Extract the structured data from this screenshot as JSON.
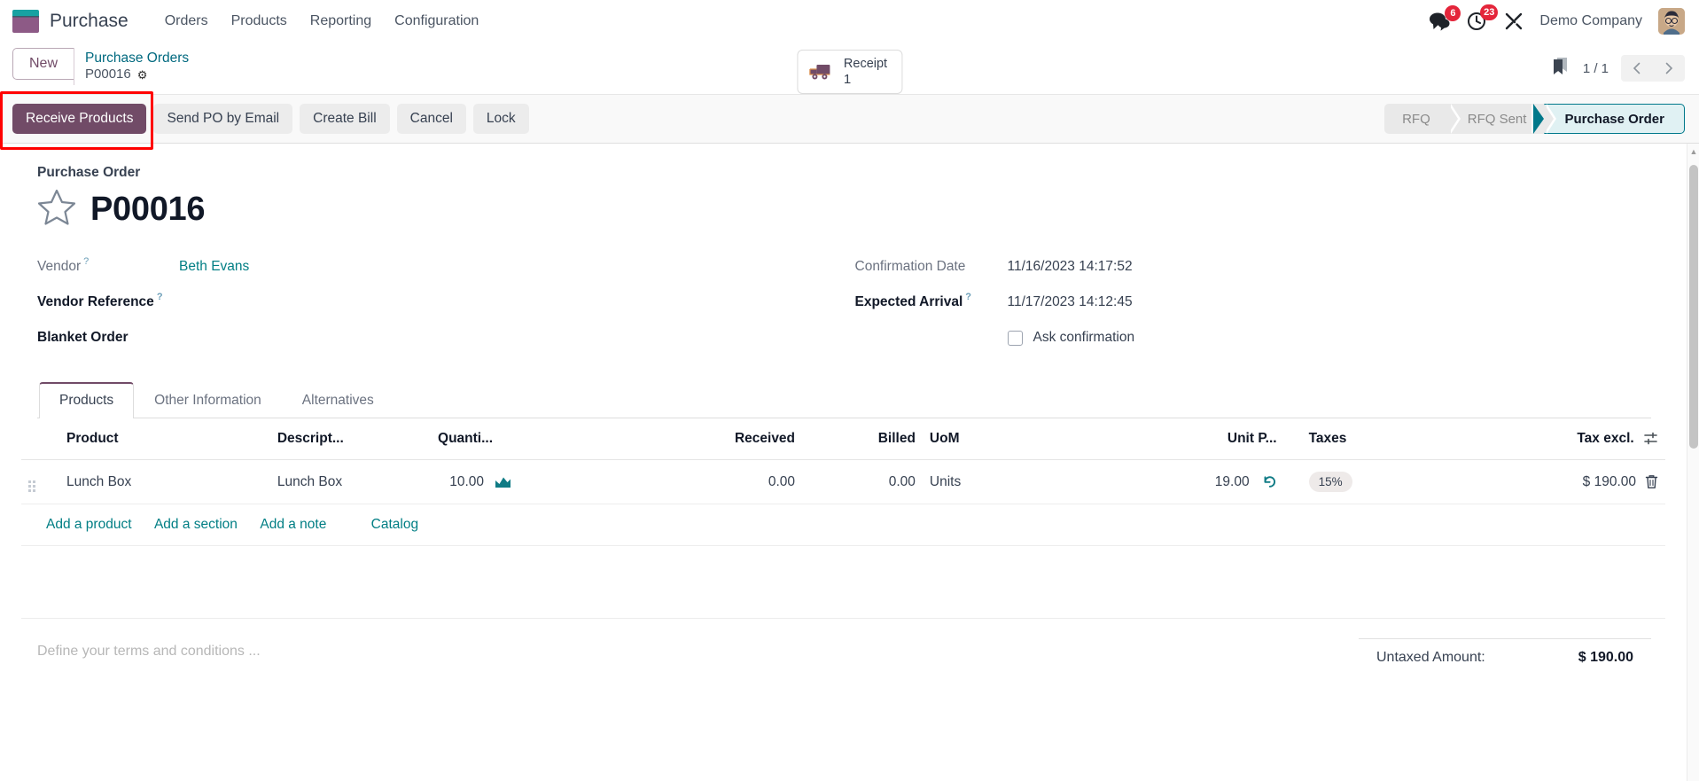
{
  "navbar": {
    "brand": "Purchase",
    "menu": [
      {
        "label": "Orders"
      },
      {
        "label": "Products"
      },
      {
        "label": "Reporting"
      },
      {
        "label": "Configuration"
      }
    ],
    "messages_count": "6",
    "activities_count": "23",
    "company": "Demo Company"
  },
  "control_panel": {
    "new_label": "New",
    "breadcrumb_parent": "Purchase Orders",
    "breadcrumb_current": "P00016",
    "smart_button": {
      "label": "Receipt",
      "value": "1"
    },
    "pager": "1 / 1"
  },
  "action_bar": {
    "buttons": [
      {
        "label": "Receive Products",
        "style": "primary",
        "highlighted": true
      },
      {
        "label": "Send PO by Email",
        "style": "secondary"
      },
      {
        "label": "Create Bill",
        "style": "secondary"
      },
      {
        "label": "Cancel",
        "style": "secondary"
      },
      {
        "label": "Lock",
        "style": "secondary"
      }
    ],
    "statusbar": [
      {
        "label": "RFQ",
        "active": false
      },
      {
        "label": "RFQ Sent",
        "active": false
      },
      {
        "label": "Purchase Order",
        "active": true
      }
    ]
  },
  "form": {
    "subtitle": "Purchase Order",
    "title": "P00016",
    "left_fields": [
      {
        "label": "Vendor",
        "help": "?",
        "value": "Beth Evans",
        "filled": true,
        "link": true
      },
      {
        "label": "Vendor Reference",
        "help": "?",
        "value": "",
        "filled": false,
        "link": false
      },
      {
        "label": "Blanket Order",
        "help": "",
        "value": "",
        "filled": false,
        "link": false
      }
    ],
    "right_fields": [
      {
        "label": "Confirmation Date",
        "help": "",
        "value": "11/16/2023 14:17:52",
        "filled": true
      },
      {
        "label": "Expected Arrival",
        "help": "?",
        "value": "11/17/2023 14:12:45",
        "filled": false
      }
    ],
    "checkbox": {
      "label": "Ask confirmation",
      "checked": false
    }
  },
  "notebook": {
    "tabs": [
      {
        "label": "Products",
        "active": true
      },
      {
        "label": "Other Information",
        "active": false
      },
      {
        "label": "Alternatives",
        "active": false
      }
    ]
  },
  "lines": {
    "columns": [
      "Product",
      "Descript...",
      "Quanti...",
      "Received",
      "Billed",
      "UoM",
      "Unit P...",
      "Taxes",
      "Tax excl."
    ],
    "rows": [
      {
        "product": "Lunch Box",
        "description": "Lunch Box",
        "quantity": "10.00",
        "received": "0.00",
        "billed": "0.00",
        "uom": "Units",
        "unit_price": "19.00",
        "taxes": "15%",
        "tax_excl": "$ 190.00"
      }
    ],
    "add_links": [
      {
        "label": "Add a product"
      },
      {
        "label": "Add a section"
      },
      {
        "label": "Add a note"
      },
      {
        "label": "Catalog"
      }
    ]
  },
  "footer": {
    "terms_placeholder": "Define your terms and conditions ...",
    "untaxed_label": "Untaxed Amount:",
    "untaxed_value": "$ 190.00"
  },
  "colors": {
    "primary": "#714b67",
    "accent_teal": "#017e84",
    "badge_red": "#e4253a",
    "highlight": "#ff0000",
    "status_active_border": "#00788a"
  }
}
